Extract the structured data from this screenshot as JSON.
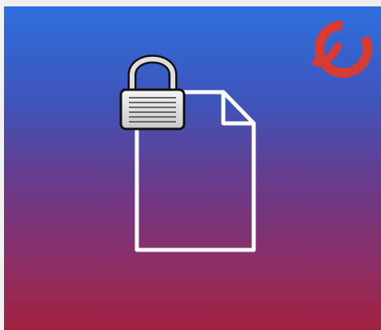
{
  "banner": {
    "gradient": {
      "top_color": "#2f6fe0",
      "upper_mid_color": "#3f54b8",
      "mid_color": "#6a3a8a",
      "lower_mid_color": "#8a2f68",
      "bottom_color": "#a32241"
    }
  },
  "icons": {
    "document": "document-icon",
    "padlock": "padlock-icon",
    "brand": "ring-logo-icon"
  },
  "colors": {
    "document_stroke": "#ffffff",
    "lock_body": "#e7e7e7",
    "lock_outline": "#111111",
    "lock_stripe": "#666666",
    "logo_red": "#d63b34"
  }
}
